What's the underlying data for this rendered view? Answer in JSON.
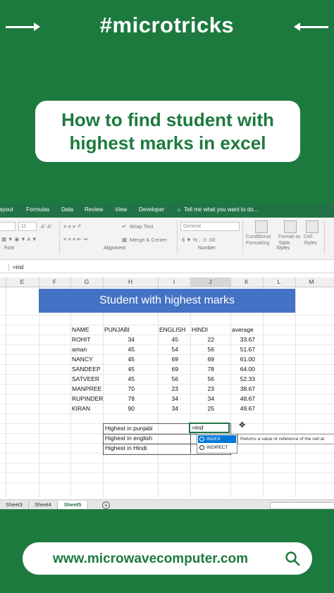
{
  "brand": {
    "tag": "#microtricks"
  },
  "title": "How to find student with\nhighest marks in excel",
  "excel": {
    "menu": [
      "ayout",
      "Formulas",
      "Data",
      "Review",
      "View",
      "Developer",
      "Tell me what you want to do..."
    ],
    "ribbon": {
      "font_size": "11",
      "wrap_text": "Wrap Text",
      "merge_center": "Merge & Center",
      "number_format": "General",
      "conditional_formatting": "Conditional Formatting",
      "format_as_table": "Format as Table",
      "cell_styles": "Cell Styles",
      "group_font": "Font",
      "group_alignment": "Alignment",
      "group_number": "Number",
      "group_styles": "Styles"
    },
    "formula_bar": "=ind",
    "columns": [
      "E",
      "F",
      "G",
      "H",
      "I",
      "J",
      "K",
      "L",
      "M"
    ],
    "banner": "Student with highest marks",
    "headers": [
      "NAME",
      "PUNJABI",
      "ENGLISH",
      "HINDI",
      "average"
    ],
    "rows": [
      [
        "ROHIT",
        "34",
        "45",
        "22",
        "33.67"
      ],
      [
        "aman",
        "45",
        "54",
        "56",
        "51.67"
      ],
      [
        "NANCY",
        "45",
        "69",
        "69",
        "61.00"
      ],
      [
        "SANDEEP",
        "45",
        "69",
        "78",
        "64.00"
      ],
      [
        "SATVEER",
        "45",
        "56",
        "56",
        "52.33"
      ],
      [
        "MANPREE",
        "70",
        "23",
        "23",
        "38.67"
      ],
      [
        "RUPINDER",
        "78",
        "34",
        "34",
        "48.67"
      ],
      [
        "KIRAN",
        "90",
        "34",
        "25",
        "49.67"
      ]
    ],
    "summary": [
      "Highest in punjabi",
      "Highest in english",
      "Highest in Hindi"
    ],
    "active_cell_value": "=ind",
    "autocomplete": [
      "INDEX",
      "INDIRECT"
    ],
    "tooltip": "Returns a value or reference of the cell at",
    "sheets": [
      "Sheet3",
      "Sheet4",
      "Sheet5"
    ],
    "add_sheet": "+"
  },
  "footer": {
    "url": "www.microwavecomputer.com"
  },
  "colors": {
    "brand_green": "#1d7a3e",
    "excel_green": "#217346",
    "banner_blue": "#4472c4"
  }
}
